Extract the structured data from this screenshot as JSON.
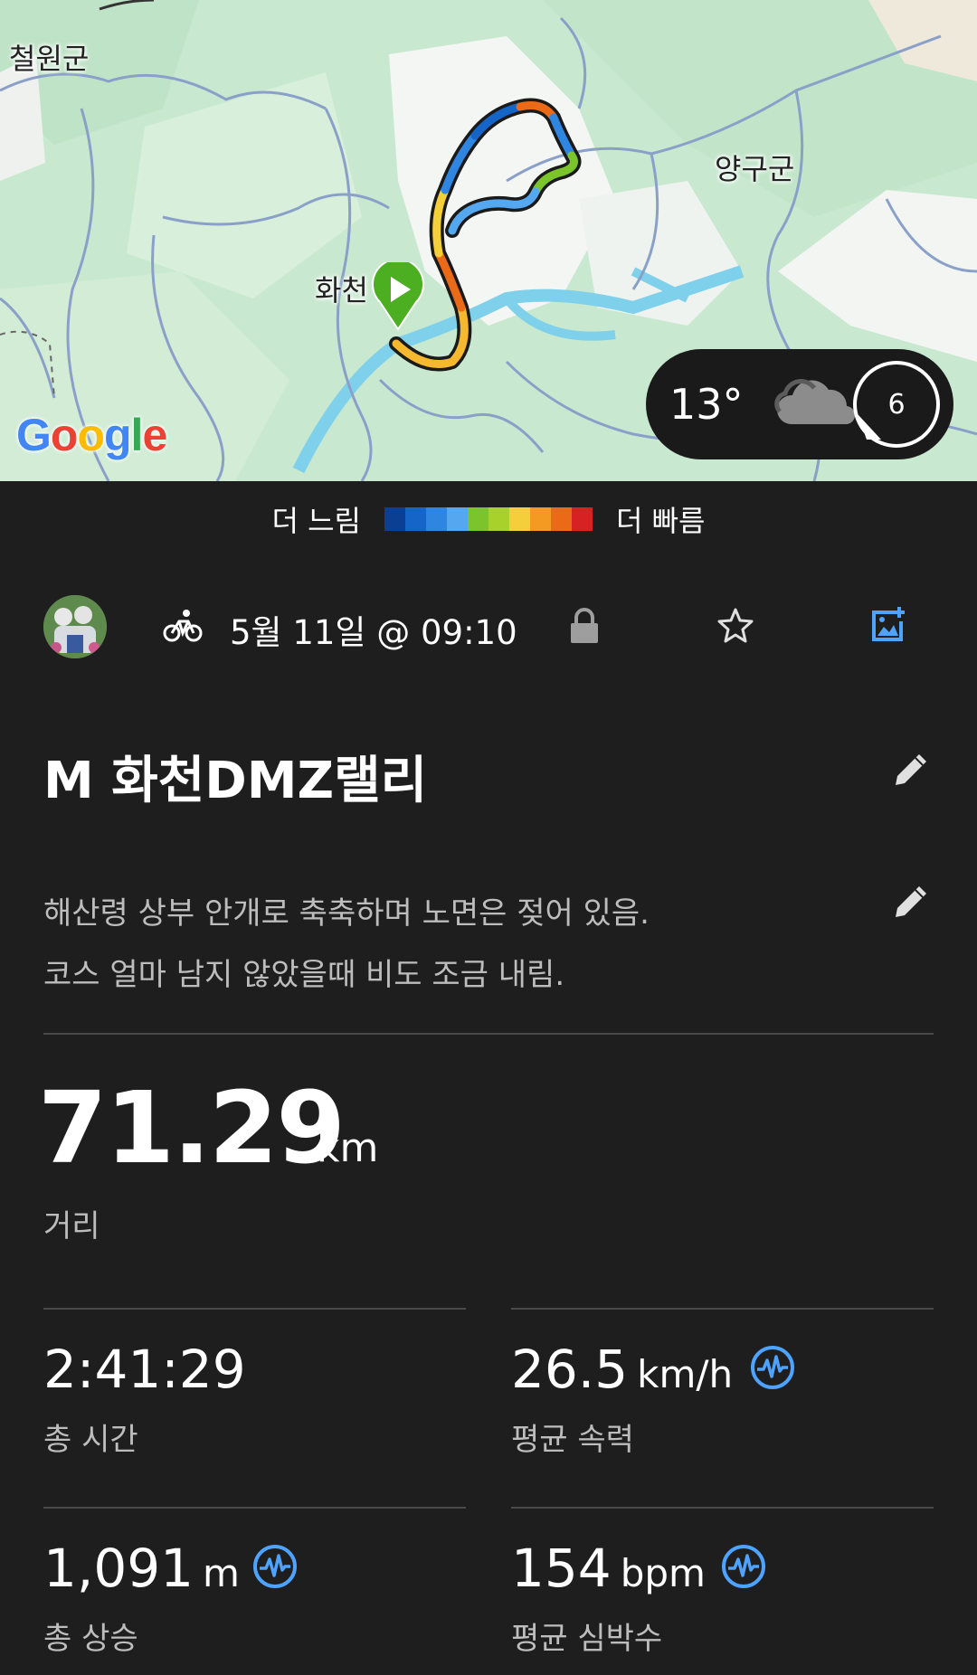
{
  "map": {
    "labels": [
      "철원군",
      "양구군",
      "화천"
    ],
    "google_logo": [
      "G",
      "o",
      "o",
      "g",
      "l",
      "e"
    ],
    "google_colors": [
      "#4285F4",
      "#EA4335",
      "#FBBC05",
      "#4285F4",
      "#34A853",
      "#EA4335"
    ],
    "weather": {
      "temperature": "13°",
      "icon": "cloud-icon",
      "wind_speed": "6"
    }
  },
  "legend": {
    "slower": "더 느림",
    "faster": "더 빠름",
    "colors": [
      "#0b3f94",
      "#1565c8",
      "#2f86e0",
      "#55a8f0",
      "#7cc42b",
      "#a8d12c",
      "#f5cf3a",
      "#f49a22",
      "#ea6a18",
      "#d62222"
    ]
  },
  "activity": {
    "type_icon": "bicycle-icon",
    "date": "5월 11일 @ 09:10",
    "title": "M 화천DMZ랠리",
    "description_lines": [
      "해산령 상부 안개로 축축하며 노면은 젖어 있음.",
      "코스 얼마 남지 않았을때 비도 조금 내림."
    ]
  },
  "stats": {
    "distance": {
      "value": "71.29",
      "unit": "km",
      "label": "거리"
    },
    "total_time": {
      "value": "2:41:29",
      "label": "총 시간"
    },
    "avg_speed": {
      "value": "26.5",
      "unit": "km/h",
      "label": "평균 속력"
    },
    "elevation_gain": {
      "value": "1,091",
      "unit": "m",
      "label": "총 상승"
    },
    "avg_heart_rate": {
      "value": "154",
      "unit": "bpm",
      "label": "평균 심박수"
    }
  },
  "accent_color": "#4da3ff"
}
